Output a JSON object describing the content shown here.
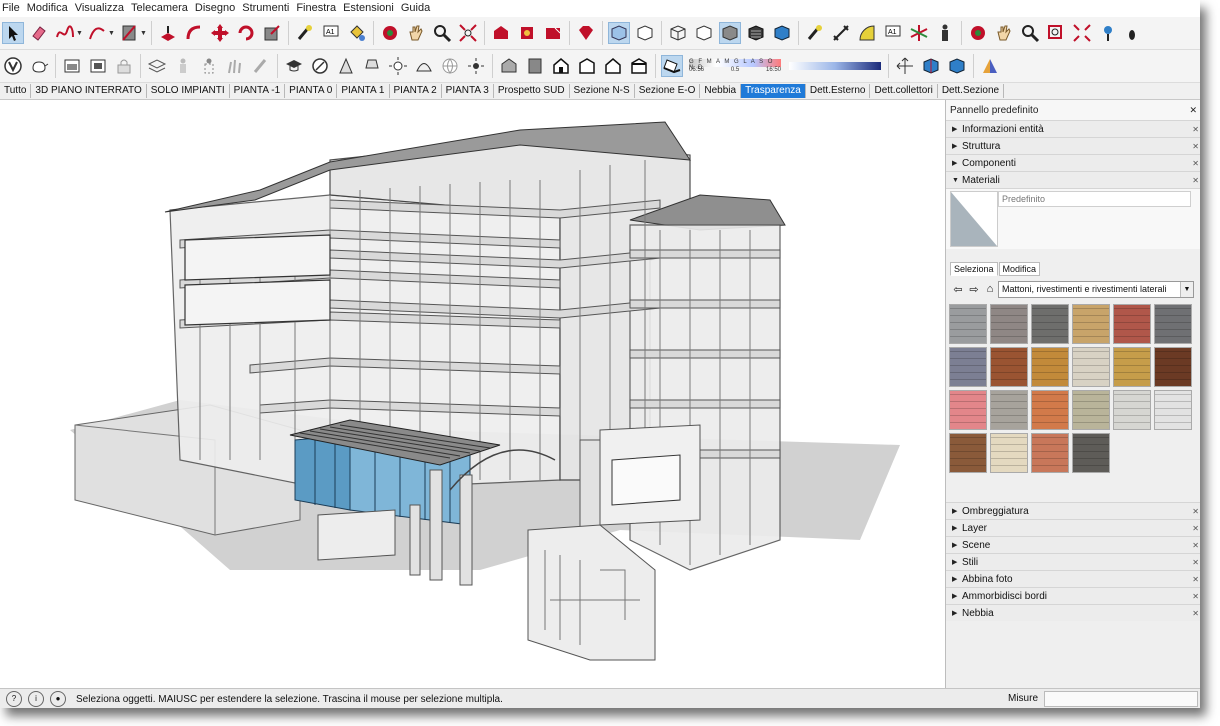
{
  "menu": [
    "File",
    "Modifica",
    "Visualizza",
    "Telecamera",
    "Disegno",
    "Strumenti",
    "Finestra",
    "Estensioni",
    "Guida"
  ],
  "fog": {
    "months": "G F M A M G L A S O N D",
    "time_start": "06:56",
    "time_mid": "0.5",
    "time_end": "16:50"
  },
  "scenes": {
    "tabs": [
      "Tutto",
      "3D PIANO INTERRATO",
      "SOLO IMPIANTI",
      "PIANTA -1",
      "PIANTA 0",
      "PIANTA 1",
      "PIANTA 2",
      "PIANTA 3",
      "Prospetto SUD",
      "Sezione N-S",
      "Sezione E-O",
      "Nebbia",
      "Trasparenza",
      "Dett.Esterno",
      "Dett.collettori",
      "Dett.Sezione"
    ],
    "selected": "Trasparenza"
  },
  "panel": {
    "title": "Pannello predefinito",
    "top_sections": [
      "Informazioni entità",
      "Struttura",
      "Componenti"
    ],
    "materials_section": "Materiali",
    "material_name": "Predefinito",
    "tab_select": "Seleziona",
    "tab_edit": "Modifica",
    "library": "Mattoni, rivestimenti e rivestimenti laterali",
    "lower_sections": [
      "Ombreggiatura",
      "Layer",
      "Scene",
      "Stili",
      "Abbina foto",
      "Ammorbidisci bordi",
      "Nebbia"
    ],
    "textures": [
      "#9a9c9e",
      "#8f8785",
      "#6e6e6c",
      "#c8a46a",
      "#b0574a",
      "#6f7073",
      "#7c7f93",
      "#9a5432",
      "#c28a3a",
      "#d8d2c4",
      "#c69d4a",
      "#6b3a24",
      "#e3868a",
      "#a7a39c",
      "#d27a4a",
      "#b9b49a",
      "#d6d6d2",
      "#e2e2e2",
      "#8a5a3a",
      "#e4d9c0",
      "#c8775a",
      "#5e5c58"
    ]
  },
  "status": {
    "message": "Seleziona oggetti. MAIUSC per estendere la selezione. Trascina il mouse per selezione multipla.",
    "measure_label": "Misure"
  }
}
